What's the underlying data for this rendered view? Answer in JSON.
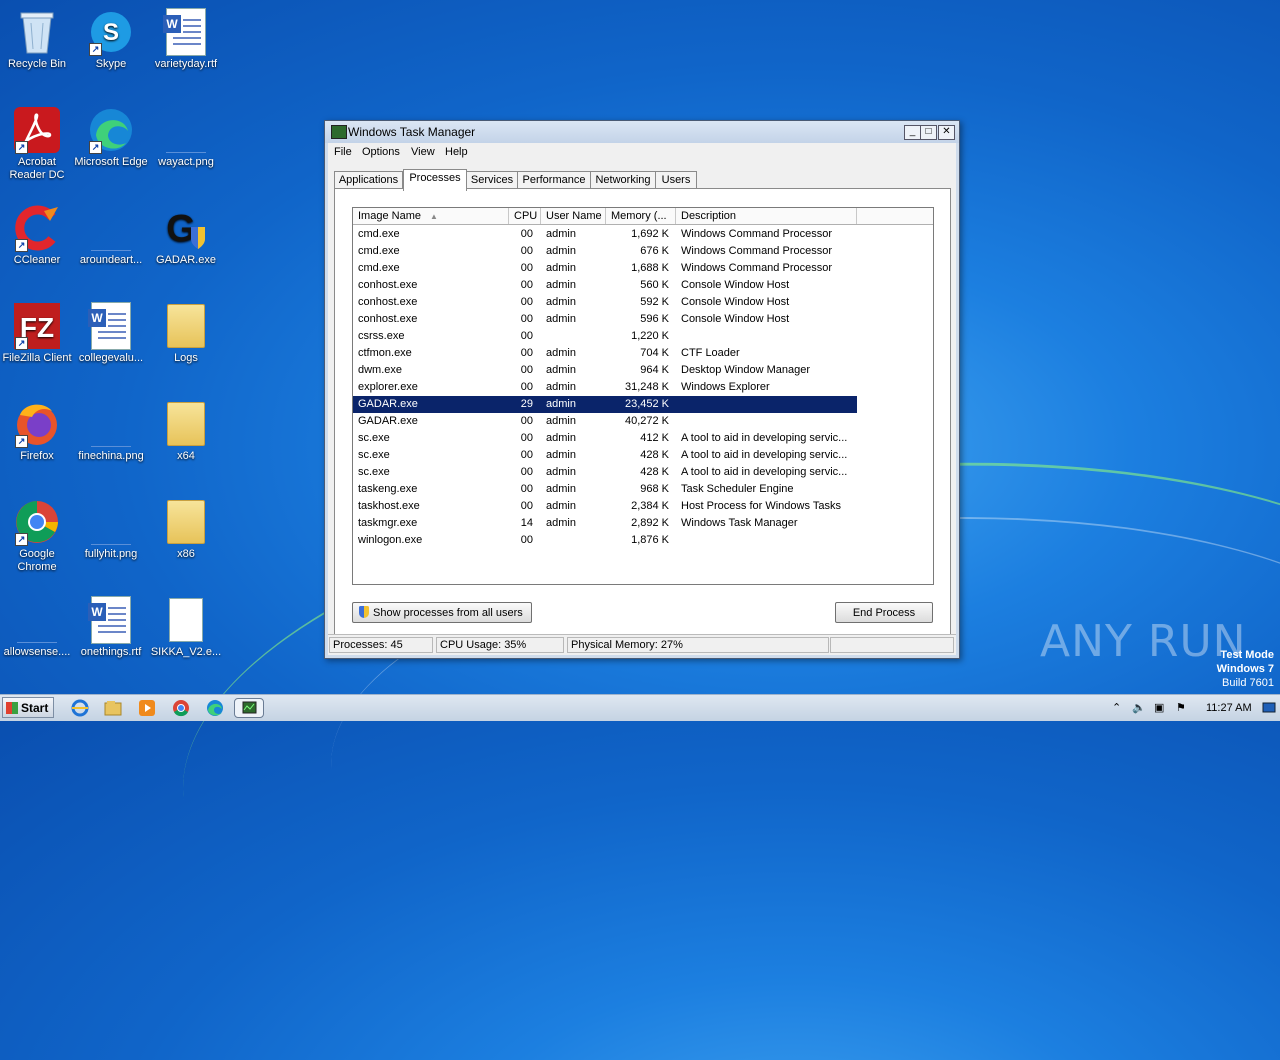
{
  "desktop": {
    "icons": [
      {
        "label": "Recycle Bin"
      },
      {
        "label": "Skype"
      },
      {
        "label": "varietyday.rtf"
      },
      {
        "label": "Acrobat Reader DC"
      },
      {
        "label": "Microsoft Edge"
      },
      {
        "label": "wayact.png"
      },
      {
        "label": "CCleaner"
      },
      {
        "label": "aroundeart..."
      },
      {
        "label": "GADAR.exe"
      },
      {
        "label": "FileZilla Client"
      },
      {
        "label": "collegevalu..."
      },
      {
        "label": "Logs"
      },
      {
        "label": "Firefox"
      },
      {
        "label": "finechina.png"
      },
      {
        "label": "x64"
      },
      {
        "label": "Google Chrome"
      },
      {
        "label": "fullyhit.png"
      },
      {
        "label": "x86"
      },
      {
        "label": "allowsense...."
      },
      {
        "label": "onethings.rtf"
      },
      {
        "label": "SIKKA_V2.e..."
      }
    ]
  },
  "window": {
    "title": "Windows Task Manager",
    "menu": [
      "File",
      "Options",
      "View",
      "Help"
    ],
    "tabs": [
      "Applications",
      "Processes",
      "Services",
      "Performance",
      "Networking",
      "Users"
    ],
    "active_tab": "Processes",
    "columns": [
      "Image Name",
      "CPU",
      "User Name",
      "Memory (...",
      "Description"
    ],
    "rows": [
      {
        "name": "cmd.exe",
        "cpu": "00",
        "user": "admin",
        "mem": "1,692 K",
        "desc": "Windows Command Processor"
      },
      {
        "name": "cmd.exe",
        "cpu": "00",
        "user": "admin",
        "mem": "676 K",
        "desc": "Windows Command Processor"
      },
      {
        "name": "cmd.exe",
        "cpu": "00",
        "user": "admin",
        "mem": "1,688 K",
        "desc": "Windows Command Processor"
      },
      {
        "name": "conhost.exe",
        "cpu": "00",
        "user": "admin",
        "mem": "560 K",
        "desc": "Console Window Host"
      },
      {
        "name": "conhost.exe",
        "cpu": "00",
        "user": "admin",
        "mem": "592 K",
        "desc": "Console Window Host"
      },
      {
        "name": "conhost.exe",
        "cpu": "00",
        "user": "admin",
        "mem": "596 K",
        "desc": "Console Window Host"
      },
      {
        "name": "csrss.exe",
        "cpu": "00",
        "user": "",
        "mem": "1,220 K",
        "desc": ""
      },
      {
        "name": "ctfmon.exe",
        "cpu": "00",
        "user": "admin",
        "mem": "704 K",
        "desc": "CTF Loader"
      },
      {
        "name": "dwm.exe",
        "cpu": "00",
        "user": "admin",
        "mem": "964 K",
        "desc": "Desktop Window Manager"
      },
      {
        "name": "explorer.exe",
        "cpu": "00",
        "user": "admin",
        "mem": "31,248 K",
        "desc": "Windows Explorer"
      },
      {
        "name": "GADAR.exe",
        "cpu": "29",
        "user": "admin",
        "mem": "23,452 K",
        "desc": ""
      },
      {
        "name": "GADAR.exe",
        "cpu": "00",
        "user": "admin",
        "mem": "40,272 K",
        "desc": ""
      },
      {
        "name": "sc.exe",
        "cpu": "00",
        "user": "admin",
        "mem": "412 K",
        "desc": "A tool to aid in developing servic..."
      },
      {
        "name": "sc.exe",
        "cpu": "00",
        "user": "admin",
        "mem": "428 K",
        "desc": "A tool to aid in developing servic..."
      },
      {
        "name": "sc.exe",
        "cpu": "00",
        "user": "admin",
        "mem": "428 K",
        "desc": "A tool to aid in developing servic..."
      },
      {
        "name": "taskeng.exe",
        "cpu": "00",
        "user": "admin",
        "mem": "968 K",
        "desc": "Task Scheduler Engine"
      },
      {
        "name": "taskhost.exe",
        "cpu": "00",
        "user": "admin",
        "mem": "2,384 K",
        "desc": "Host Process for Windows Tasks"
      },
      {
        "name": "taskmgr.exe",
        "cpu": "14",
        "user": "admin",
        "mem": "2,892 K",
        "desc": "Windows Task Manager"
      },
      {
        "name": "winlogon.exe",
        "cpu": "00",
        "user": "",
        "mem": "1,876 K",
        "desc": ""
      }
    ],
    "selected_row": 10,
    "show_all_label": "Show processes from all users",
    "end_process_label": "End Process",
    "status": {
      "processes": "Processes: 45",
      "cpu": "CPU Usage: 35%",
      "memory": "Physical Memory: 27%"
    }
  },
  "taskbar": {
    "start_label": "Start",
    "clock": "11:27 AM"
  },
  "overlay": {
    "watermark": "ANY RUN",
    "test_mode": "Test Mode",
    "os": "Windows 7",
    "build": "Build 7601"
  }
}
